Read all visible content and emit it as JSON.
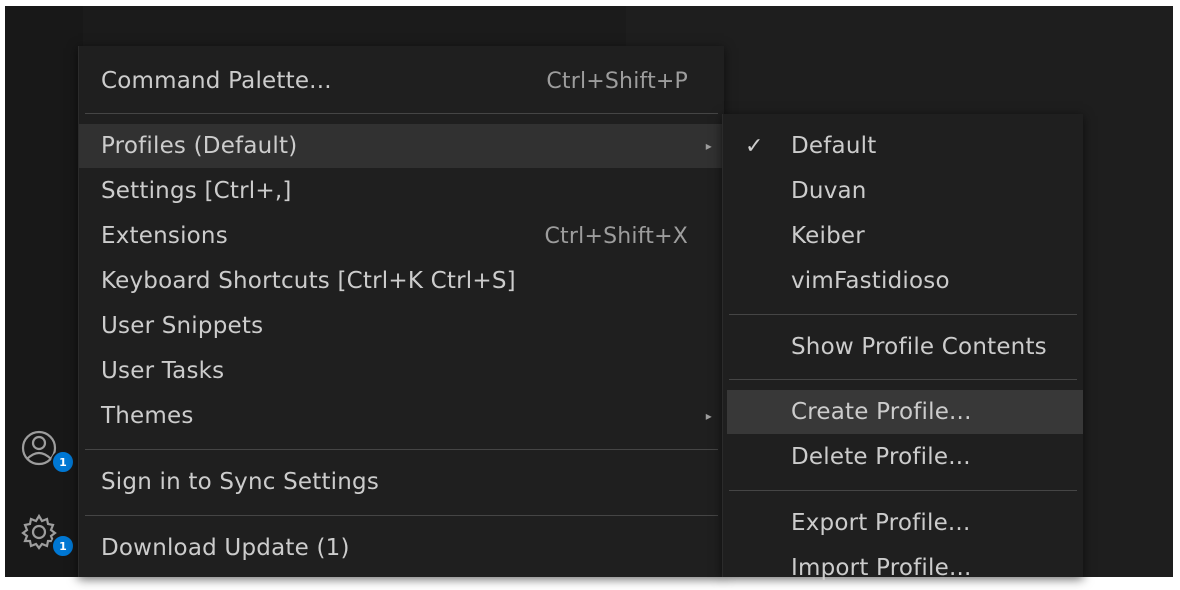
{
  "main_menu": {
    "command_palette": {
      "label": "Command Palette...",
      "shortcut": "Ctrl+Shift+P"
    },
    "profiles": {
      "label": "Profiles (Default)"
    },
    "settings": {
      "label": "Settings [Ctrl+,]"
    },
    "extensions": {
      "label": "Extensions",
      "shortcut": "Ctrl+Shift+X"
    },
    "keyboard_shortcuts": {
      "label": "Keyboard Shortcuts [Ctrl+K Ctrl+S]"
    },
    "user_snippets": {
      "label": "User Snippets"
    },
    "user_tasks": {
      "label": "User Tasks"
    },
    "themes": {
      "label": "Themes"
    },
    "sign_in": {
      "label": "Sign in to Sync Settings"
    },
    "download_update": {
      "label": "Download Update (1)"
    }
  },
  "profiles_submenu": {
    "default": {
      "label": "Default",
      "checked": true
    },
    "duvan": {
      "label": "Duvan"
    },
    "keiber": {
      "label": "Keiber"
    },
    "vimfastidioso": {
      "label": "vimFastidioso"
    },
    "show_contents": {
      "label": "Show Profile Contents"
    },
    "create": {
      "label": "Create Profile..."
    },
    "delete": {
      "label": "Delete Profile..."
    },
    "export": {
      "label": "Export Profile..."
    },
    "import": {
      "label": "Import Profile..."
    }
  },
  "activity_bar": {
    "accounts": {
      "icon": "account-icon",
      "badge": "1"
    },
    "manage": {
      "icon": "gear-icon",
      "badge": "1"
    }
  },
  "icons": {
    "check": "✓",
    "submenu_arrow": "▸"
  },
  "colors": {
    "accent": "#0078d4",
    "menu_bg": "#1f1f1f",
    "highlight": "#313131"
  }
}
